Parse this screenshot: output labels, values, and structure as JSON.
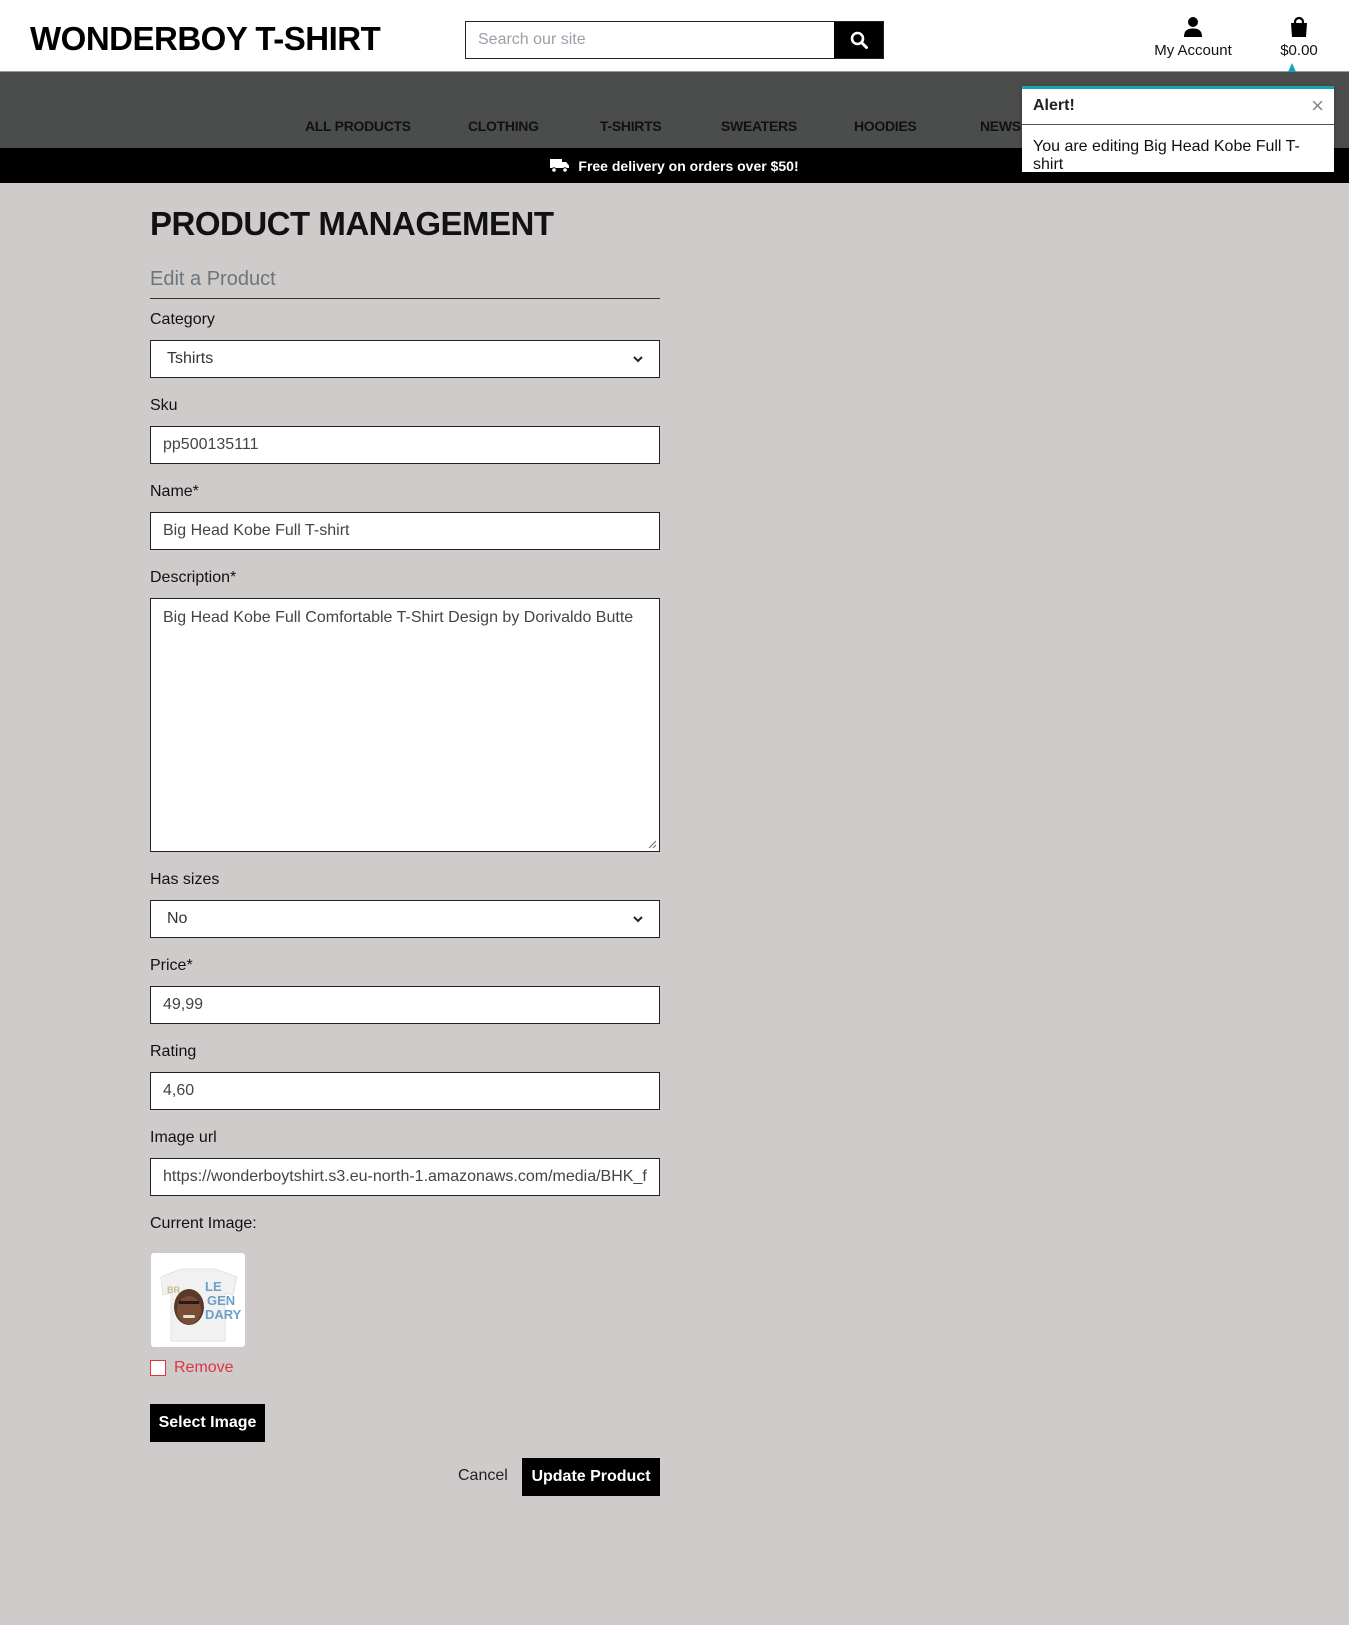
{
  "header": {
    "brand": "WONDERBOY T-SHIRT",
    "search_placeholder": "Search our site",
    "account_label": "My Account",
    "bag_total": "$0.00"
  },
  "nav": {
    "items": [
      "ALL PRODUCTS",
      "CLOTHING",
      "T-SHIRTS",
      "SWEATERS",
      "HOODIES",
      "NEWS"
    ]
  },
  "banner": {
    "delivery_text": "Free delivery on orders over $50!"
  },
  "alert": {
    "title": "Alert!",
    "close_glyph": "×",
    "message": "You are editing Big Head Kobe Full T-shirt"
  },
  "page": {
    "title": "PRODUCT MANAGEMENT",
    "subtitle": "Edit a Product"
  },
  "form": {
    "category_label": "Category",
    "category_value": "Tshirts",
    "sku_label": "Sku",
    "sku_value": "pp500135111",
    "name_label": "Name*",
    "name_value": "Big Head Kobe Full T-shirt",
    "description_label": "Description*",
    "description_value": "Big Head Kobe Full Comfortable T-Shirt Design by Dorivaldo Butte",
    "has_sizes_label": "Has sizes",
    "has_sizes_value": "No",
    "price_label": "Price*",
    "price_value": "49,99",
    "rating_label": "Rating",
    "rating_value": "4,60",
    "image_url_label": "Image url",
    "image_url_value": "https://wonderboytshirt.s3.eu-north-1.amazonaws.com/media/BHK_f",
    "current_image_label": "Current Image:",
    "remove_label": "Remove",
    "select_image_label": "Select Image",
    "cancel_label": "Cancel",
    "update_label": "Update Product"
  },
  "colors": {
    "page_bg": "#cfcbcb",
    "nav_bg": "#4b4d4d",
    "alert_accent": "#17a2b8",
    "danger": "#dc3545"
  },
  "icons": [
    "search-icon",
    "user-icon",
    "shopping-bag-icon",
    "truck-icon",
    "close-icon",
    "chevron-down-icon"
  ]
}
